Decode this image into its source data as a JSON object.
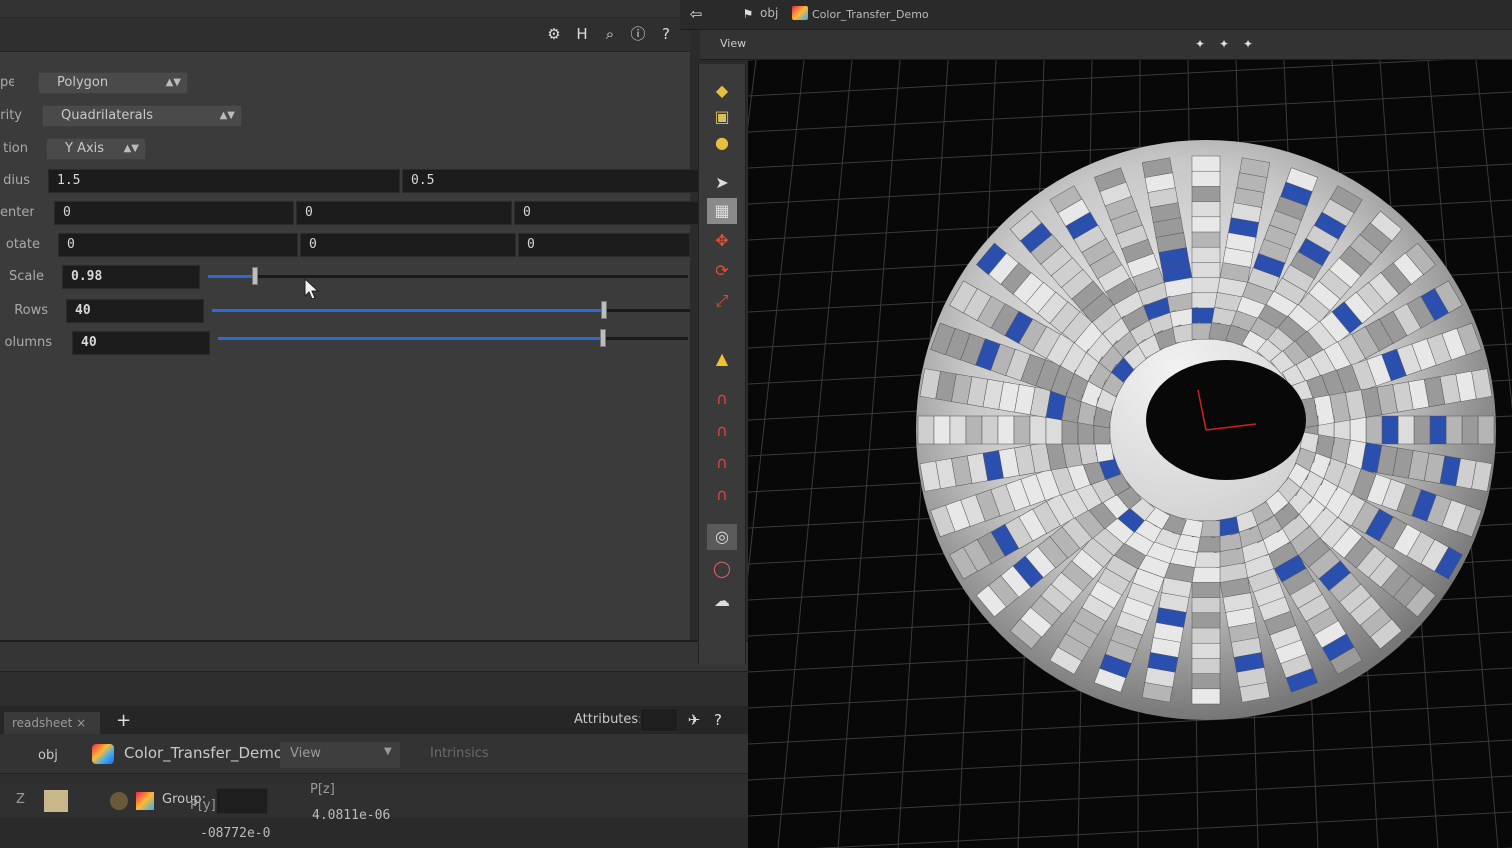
{
  "params": {
    "rows": [
      {
        "label": "pe",
        "menu": "Polygon"
      },
      {
        "label": "rity",
        "menu": "Quadrilaterals"
      },
      {
        "label": "tion",
        "menu": "Y Axis"
      }
    ],
    "radius": {
      "label": "dius",
      "v1": "1.5",
      "v2": "0.5"
    },
    "center": {
      "label": "enter",
      "v1": "0",
      "v2": "0",
      "v3": "0"
    },
    "rotate": {
      "label": "otate",
      "v1": "0",
      "v2": "0",
      "v3": "0"
    },
    "scale": {
      "label": "Scale",
      "value": "0.98",
      "level": 0.098
    },
    "rows_param": {
      "label": "Rows",
      "value": "40",
      "level": 0.82
    },
    "columns_param": {
      "label": "olumns",
      "value": "40",
      "level": 0.82
    }
  },
  "pathbar": {
    "obj": "obj",
    "node": "Color_Transfer_Demo"
  },
  "viewport": {
    "tab": "View"
  },
  "spreadsheet": {
    "tab": "readsheet",
    "add": "+",
    "obj": "obj",
    "node": "Color_Transfer_Demo",
    "view_btn": "View",
    "intrinsics": "Intrinsics",
    "attributes": "Attributes:",
    "group": "Group:",
    "col_py": "P[y]",
    "col_pz": "P[z]",
    "val_pz": "4.0811e-06",
    "val_py": "-08772e-0",
    "small_z": "Z"
  },
  "colors": {
    "accent": "#2a6cd6",
    "viewport_bg": "#080808",
    "panel": "#3b3b3b"
  }
}
